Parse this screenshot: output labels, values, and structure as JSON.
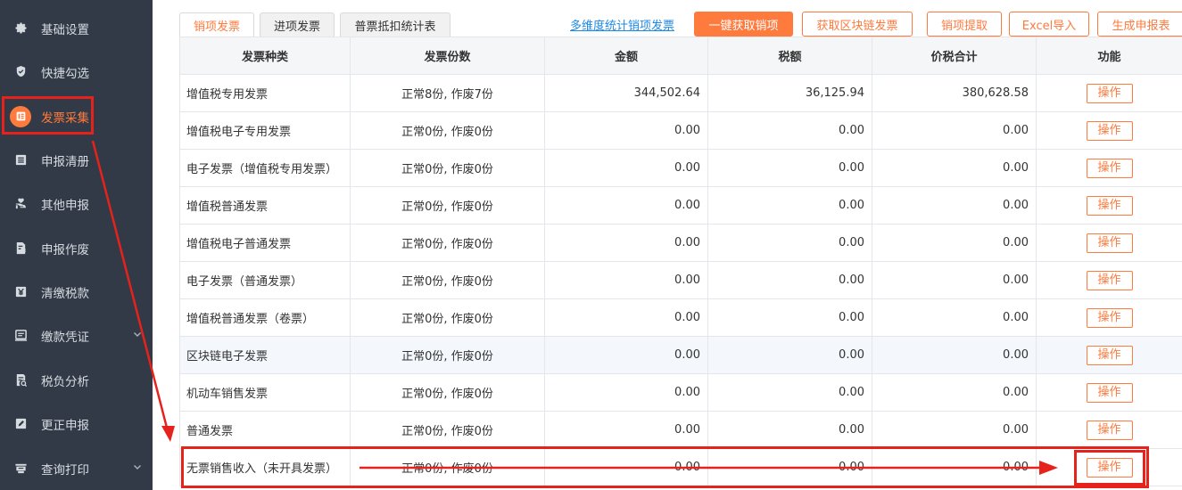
{
  "sidebar": {
    "items": [
      {
        "label": "基础设置",
        "icon": "gear-icon"
      },
      {
        "label": "快捷勾选",
        "icon": "shield-check-icon"
      },
      {
        "label": "发票采集",
        "icon": "invoice-icon",
        "active": true
      },
      {
        "label": "申报清册",
        "icon": "list-icon"
      },
      {
        "label": "其他申报",
        "icon": "hand-heart-icon"
      },
      {
        "label": "申报作废",
        "icon": "document-cancel-icon"
      },
      {
        "label": "清缴税款",
        "icon": "yuan-icon"
      },
      {
        "label": "缴款凭证",
        "icon": "voucher-icon",
        "has_chevron": true
      },
      {
        "label": "税负分析",
        "icon": "analysis-icon"
      },
      {
        "label": "更正申报",
        "icon": "edit-icon"
      },
      {
        "label": "查询打印",
        "icon": "printer-icon",
        "has_chevron": true
      }
    ]
  },
  "tabs": [
    {
      "label": "销项发票",
      "active": true
    },
    {
      "label": "进项发票"
    },
    {
      "label": "普票抵扣统计表"
    }
  ],
  "toolbar": {
    "stats_link": "多维度统计销项发票",
    "btn_fetch_sales": "一键获取销项",
    "btn_fetch_blockchain": "获取区块链发票",
    "btn_extract_sales": "销项提取",
    "btn_excel_import": "Excel导入",
    "btn_generate_report": "生成申报表"
  },
  "table": {
    "headers": [
      "发票种类",
      "发票份数",
      "金额",
      "税额",
      "价税合计",
      "功能"
    ],
    "rows": [
      {
        "type": "增值税专用发票",
        "count": "正常8份, 作废7份",
        "amount": "344,502.64",
        "tax": "36,125.94",
        "total": "380,628.58",
        "op": "操作"
      },
      {
        "type": "增值税电子专用发票",
        "count": "正常0份, 作废0份",
        "amount": "0.00",
        "tax": "0.00",
        "total": "0.00",
        "op": "操作"
      },
      {
        "type": "电子发票（增值税专用发票）",
        "count": "正常0份, 作废0份",
        "amount": "0.00",
        "tax": "0.00",
        "total": "0.00",
        "op": "操作"
      },
      {
        "type": "增值税普通发票",
        "count": "正常0份, 作废0份",
        "amount": "0.00",
        "tax": "0.00",
        "total": "0.00",
        "op": "操作"
      },
      {
        "type": "增值税电子普通发票",
        "count": "正常0份, 作废0份",
        "amount": "0.00",
        "tax": "0.00",
        "total": "0.00",
        "op": "操作"
      },
      {
        "type": "电子发票（普通发票）",
        "count": "正常0份, 作废0份",
        "amount": "0.00",
        "tax": "0.00",
        "total": "0.00",
        "op": "操作"
      },
      {
        "type": "增值税普通发票（卷票）",
        "count": "正常0份, 作废0份",
        "amount": "0.00",
        "tax": "0.00",
        "total": "0.00",
        "op": "操作"
      },
      {
        "type": "区块链电子发票",
        "count": "正常0份, 作废0份",
        "amount": "0.00",
        "tax": "0.00",
        "total": "0.00",
        "op": "操作",
        "highlight": true
      },
      {
        "type": "机动车销售发票",
        "count": "正常0份, 作废0份",
        "amount": "0.00",
        "tax": "0.00",
        "total": "0.00",
        "op": "操作"
      },
      {
        "type": "普通发票",
        "count": "正常0份, 作废0份",
        "amount": "0.00",
        "tax": "0.00",
        "total": "0.00",
        "op": "操作"
      },
      {
        "type": "无票销售收入（未开具发票）",
        "count": "正常0份, 作废0份",
        "amount": "0.00",
        "tax": "0.00",
        "total": "0.00",
        "op": "操作"
      }
    ]
  },
  "colors": {
    "sidebar_bg": "#313a46",
    "accent": "#ff7a3d",
    "link": "#1e88e5",
    "annotation": "#e5231c"
  }
}
